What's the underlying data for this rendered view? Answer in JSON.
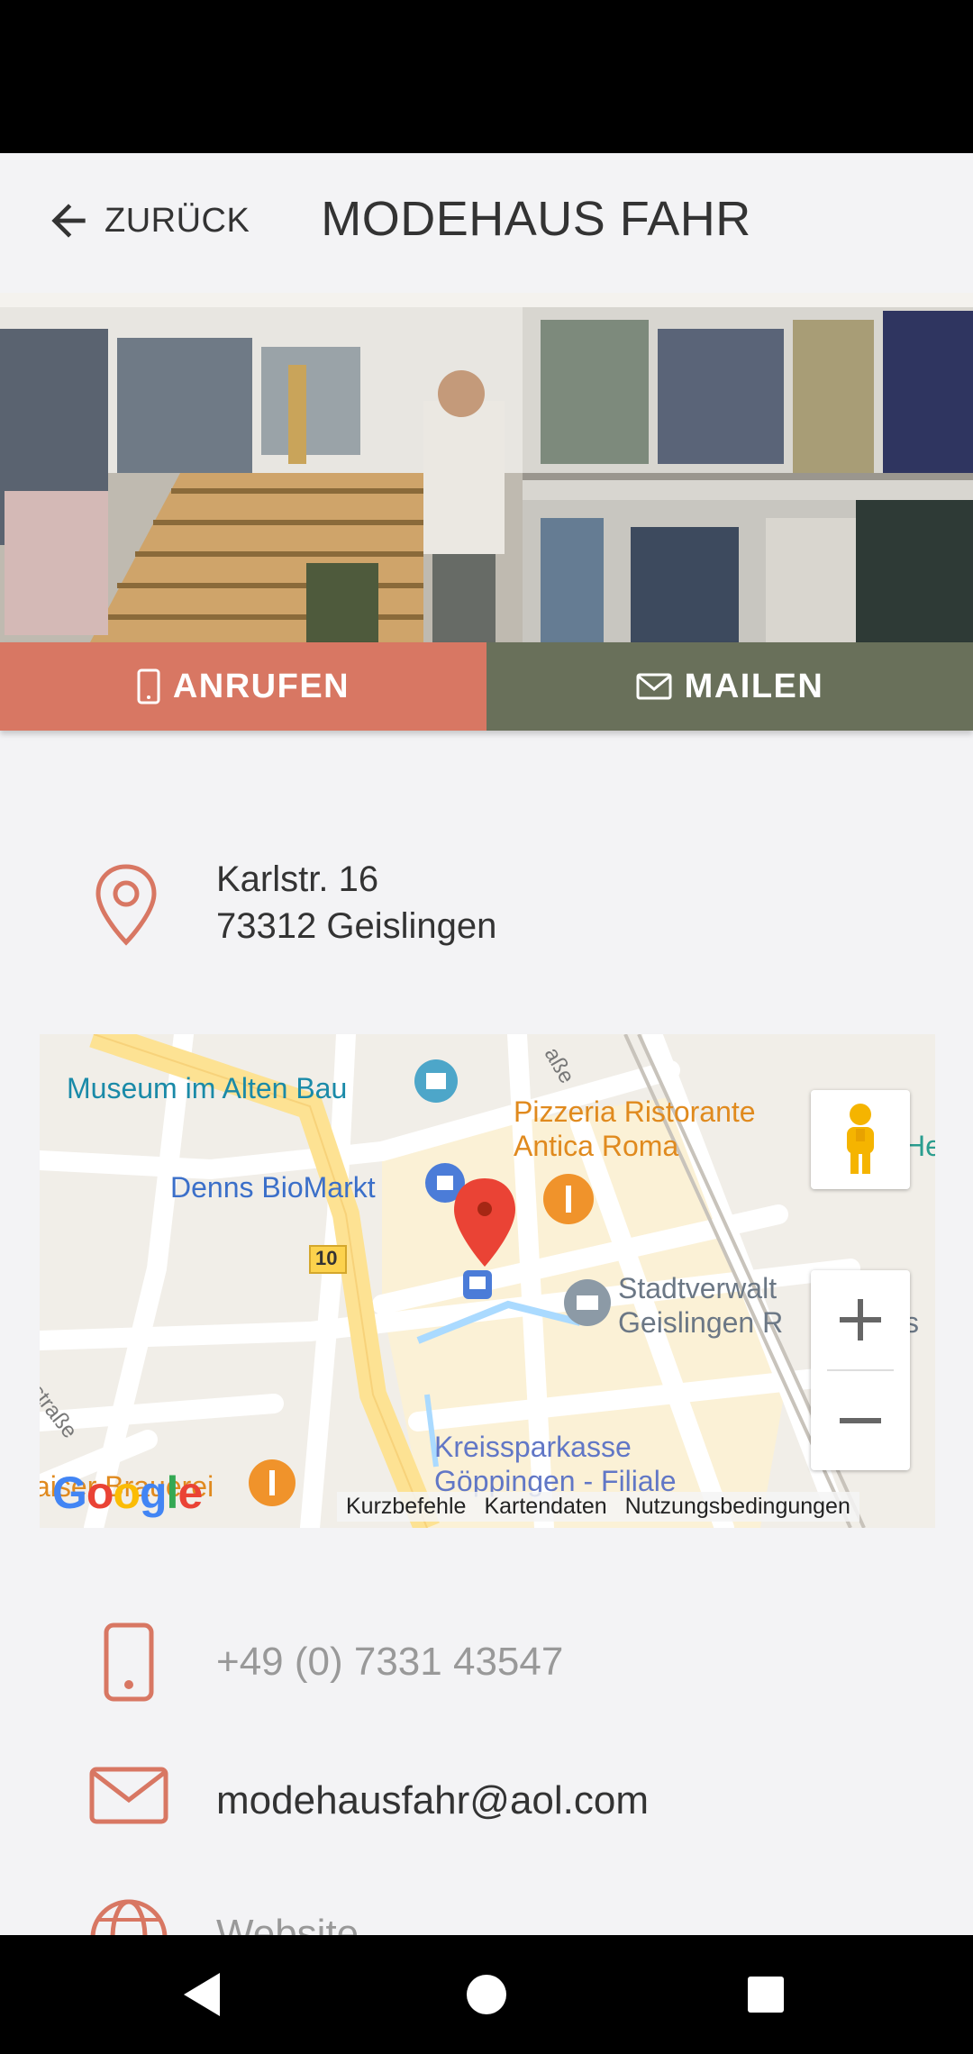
{
  "header": {
    "back_label": "ZURÜCK",
    "title": "MODEHAUS FAHR"
  },
  "actions": {
    "call_label": "ANRUFEN",
    "mail_label": "MAILEN"
  },
  "address": {
    "street": "Karlstr. 16",
    "city": "73312 Geislingen"
  },
  "map": {
    "labels": {
      "museum": "Museum im Alten Bau",
      "pizzeria_line1": "Pizzeria Ristorante",
      "pizzeria_line2": "Antica Roma",
      "denns": "Denns BioMarkt",
      "route": "10",
      "stadt_line1": "Stadtverwalt",
      "stadt_line2": "Geislingen R",
      "kreis_line1": "Kreissparkasse",
      "kreis_line2": "Göppingen - Filiale",
      "street_a": "ßstraße",
      "street_b": "aße",
      "brauerei": "aiser Brauerei",
      "edge_h": "He",
      "edge_s": "s"
    },
    "google": "Google",
    "footer": {
      "shortcuts": "Kurzbefehle",
      "mapdata": "Kartendaten",
      "terms": "Nutzungsbedingungen"
    }
  },
  "contact": {
    "phone": "+49 (0) 7331 43547",
    "email": "modehausfahr@aol.com",
    "website": "Website"
  },
  "colors": {
    "accent": "#d87763",
    "mail_green": "#69705a",
    "background": "#f3f3f5"
  }
}
